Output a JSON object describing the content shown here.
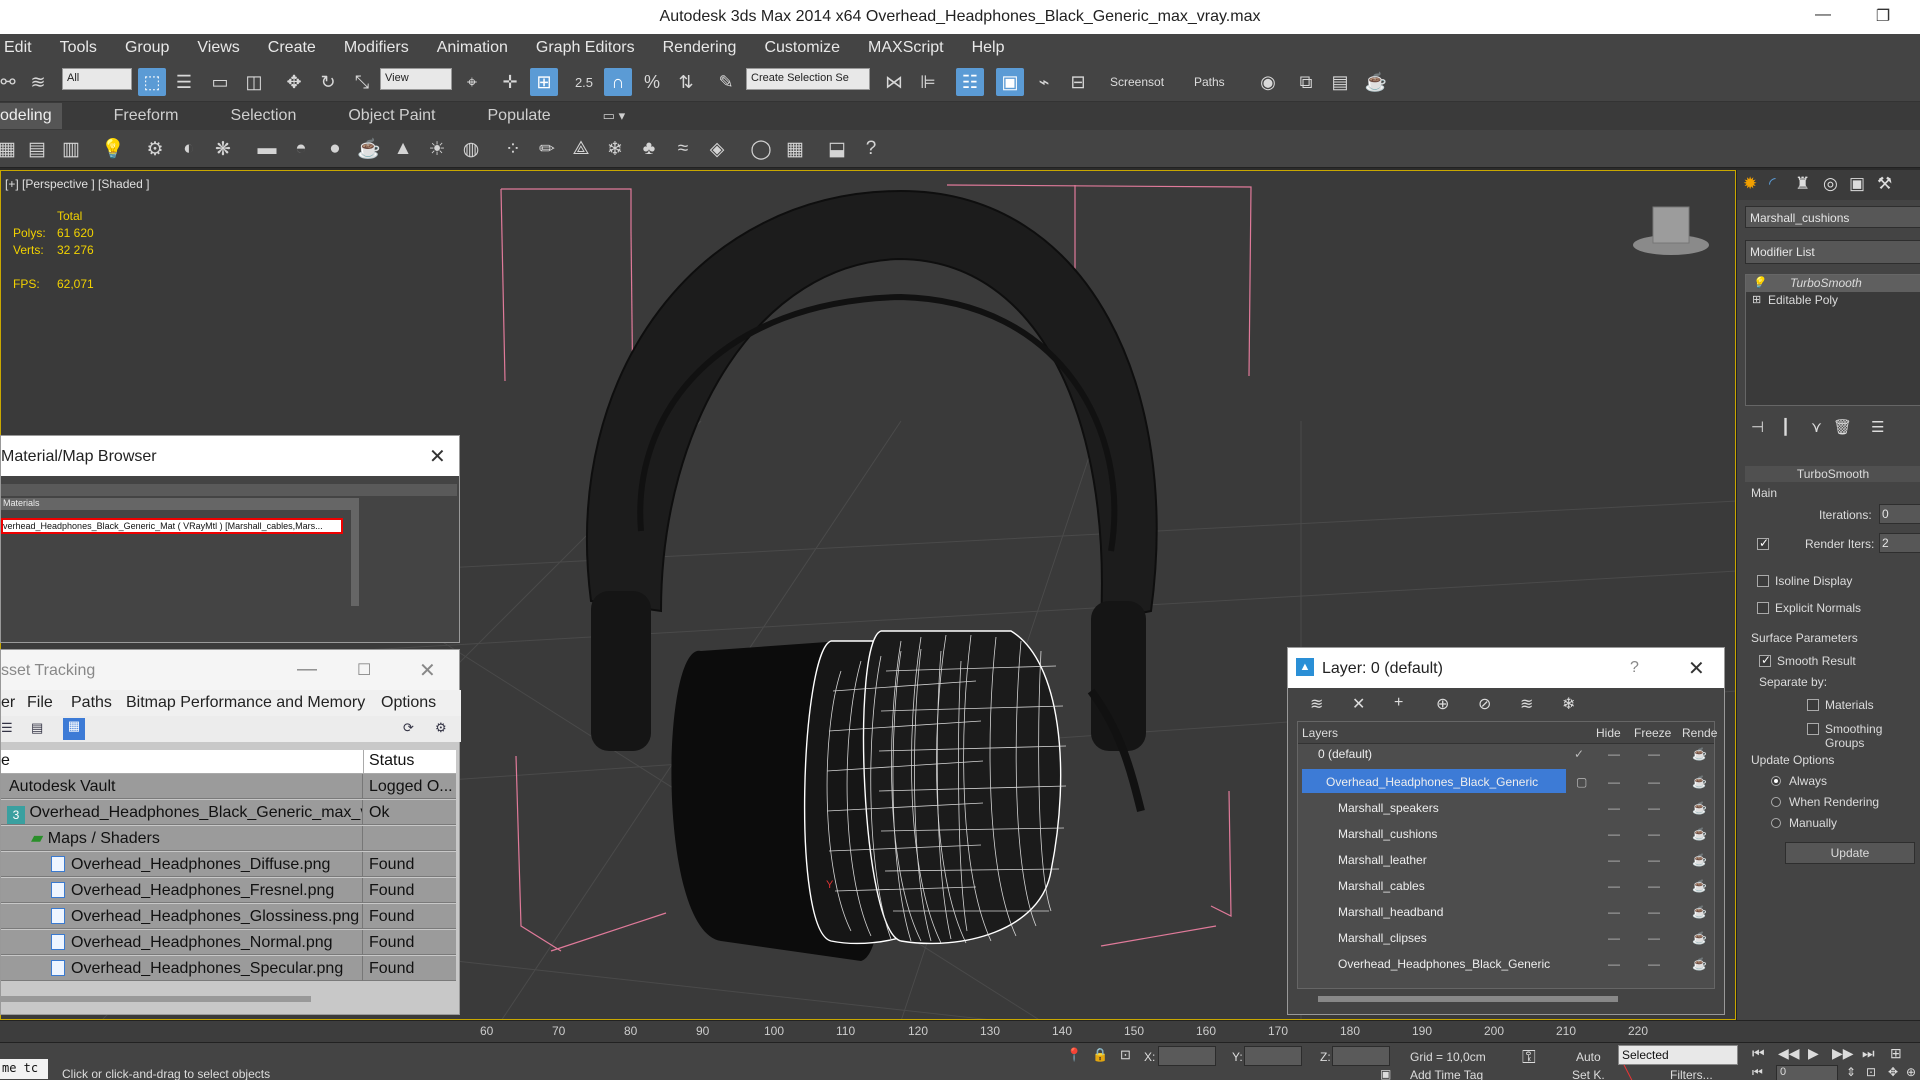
{
  "window": {
    "title": "Autodesk 3ds Max  2014 x64     Overhead_Headphones_Black_Generic_max_vray.max",
    "minimize": "—",
    "restore": "❐"
  },
  "menu": [
    "Edit",
    "Tools",
    "Group",
    "Views",
    "Create",
    "Modifiers",
    "Animation",
    "Graph Editors",
    "Rendering",
    "Customize",
    "MAXScript",
    "Help"
  ],
  "toolbar": {
    "filter": "All",
    "ref_coord": "View",
    "snap_angle": "2.5",
    "selection_set": "Create Selection Se",
    "screensot": "Screensot",
    "paths": "Paths"
  },
  "ribbon": {
    "tabs": [
      "odeling",
      "Freeform",
      "Selection",
      "Object Paint",
      "Populate"
    ]
  },
  "viewport": {
    "label": "[+] [Perspective ] [Shaded ]",
    "stats": {
      "total_label": "Total",
      "polys_label": "Polys:",
      "polys": "61 620",
      "verts_label": "Verts:",
      "verts": "32 276",
      "fps_label": "FPS:",
      "fps": "62,071"
    },
    "axis": "Y"
  },
  "command_panel": {
    "object_name": "Marshall_cushions",
    "modifier_list": "Modifier List",
    "stack": [
      "TurboSmooth",
      "Editable Poly"
    ],
    "rollout": "TurboSmooth",
    "main": "Main",
    "iterations_label": "Iterations:",
    "iterations": "0",
    "render_iters_label": "Render Iters:",
    "render_iters": "2",
    "isoline": "Isoline Display",
    "explicit_normals": "Explicit Normals",
    "surface_params": "Surface Parameters",
    "smooth_result": "Smooth Result",
    "separate_by": "Separate by:",
    "materials": "Materials",
    "smoothing_groups": "Smoothing Groups",
    "update_options": "Update Options",
    "always": "Always",
    "when_rendering": "When Rendering",
    "manually": "Manually",
    "update": "Update"
  },
  "material_browser": {
    "title": "Material/Map Browser",
    "section": "Materials",
    "item": "verhead_Headphones_Black_Generic_Mat ( VRayMtl ) [Marshall_cables,Mars...",
    "close": "✕"
  },
  "asset_tracking": {
    "title": "sset Tracking",
    "menu": [
      "er",
      "File",
      "Paths",
      "Bitmap Performance and Memory",
      "Options"
    ],
    "col_name": "e",
    "col_status": "Status",
    "rows": [
      {
        "name": "Autodesk Vault",
        "status": "Logged O..."
      },
      {
        "name": "Overhead_Headphones_Black_Generic_max_vr...",
        "status": "Ok"
      },
      {
        "name": "Maps / Shaders",
        "status": ""
      },
      {
        "name": "Overhead_Headphones_Diffuse.png",
        "status": "Found"
      },
      {
        "name": "Overhead_Headphones_Fresnel.png",
        "status": "Found"
      },
      {
        "name": "Overhead_Headphones_Glossiness.png",
        "status": "Found"
      },
      {
        "name": "Overhead_Headphones_Normal.png",
        "status": "Found"
      },
      {
        "name": "Overhead_Headphones_Specular.png",
        "status": "Found"
      }
    ],
    "minimize": "—",
    "maximize": "☐",
    "close": "✕"
  },
  "layer_dialog": {
    "title": "Layer: 0 (default)",
    "help": "?",
    "close": "✕",
    "col_layers": "Layers",
    "col_hide": "Hide",
    "col_freeze": "Freeze",
    "col_render": "Rende",
    "rows": [
      "0 (default)",
      "Overhead_Headphones_Black_Generic",
      "Marshall_speakers",
      "Marshall_cushions",
      "Marshall_leather",
      "Marshall_cables",
      "Marshall_headband",
      "Marshall_clipses",
      "Overhead_Headphones_Black_Generic"
    ]
  },
  "timeline": {
    "ticks": [
      "60",
      "70",
      "80",
      "90",
      "100",
      "110",
      "120",
      "130",
      "140",
      "150",
      "160",
      "170",
      "180",
      "190",
      "200",
      "210",
      "220"
    ]
  },
  "status": {
    "prompt": "Click or click-and-drag to select objects",
    "left_box": "me  tc",
    "x_label": "X:",
    "y_label": "Y:",
    "z_label": "Z:",
    "grid": "Grid = 10,0cm",
    "auto": "Auto",
    "selected": "Selected",
    "setk": "Set K.",
    "filters": "Filters...",
    "add_time_tag": "Add Time Tag",
    "frame": "0"
  },
  "colors": {
    "accent": "#5b9bd5",
    "stats": "#f2d200",
    "bbox": "#e07a9a",
    "selection_blue": "#3d7bd6"
  }
}
